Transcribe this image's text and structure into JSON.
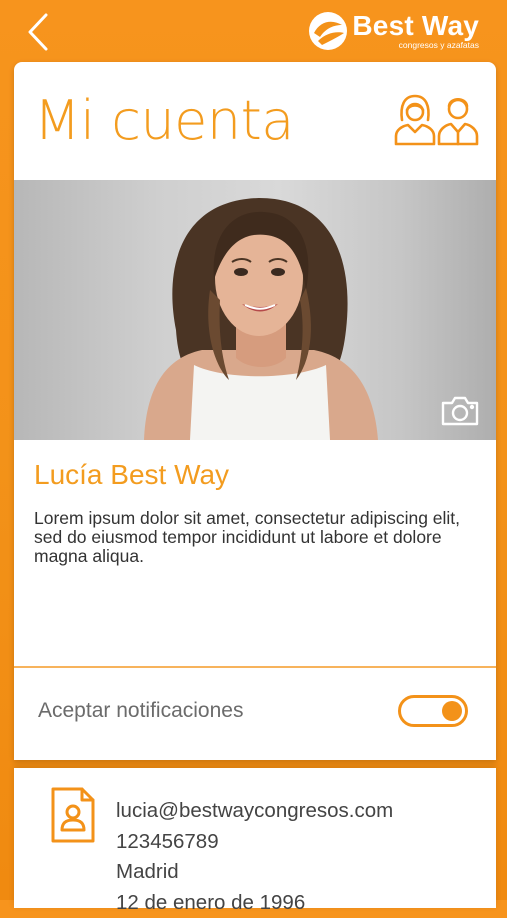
{
  "header": {
    "logo_title": "Best Way",
    "logo_subtitle": "congresos y azafatas"
  },
  "account": {
    "title": "Mi cuenta",
    "name": "Lucía Best Way",
    "bio": "Lorem ipsum dolor sit amet, consectetur adipiscing elit, sed do eiusmod tempor incididunt ut labore et dolore magna aliqua."
  },
  "notifications": {
    "label": "Aceptar notificaciones",
    "enabled": true
  },
  "contact": {
    "email": "lucia@bestwaycongresos.com",
    "phone": "123456789",
    "city": "Madrid",
    "birthdate": "12 de enero de 1996"
  },
  "colors": {
    "accent": "#f39219",
    "text_orange": "#f39c1f"
  },
  "icons": {
    "back": "chevron-left-icon",
    "brand": "best-way-logo",
    "users": "users-icon",
    "camera": "camera-icon",
    "contact": "contact-card-icon"
  }
}
